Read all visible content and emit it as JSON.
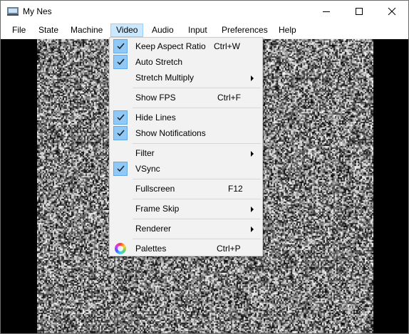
{
  "window": {
    "title": "My Nes"
  },
  "menubar": {
    "items": [
      "File",
      "State",
      "Machine",
      "Video",
      "Audio",
      "Input",
      "Preferences",
      "Help"
    ],
    "open_item": "Video"
  },
  "video_menu": {
    "keep_aspect_ratio": {
      "label": "Keep Aspect Ratio",
      "shortcut": "Ctrl+W",
      "checked": true
    },
    "auto_stretch": {
      "label": "Auto Stretch",
      "checked": true
    },
    "stretch_multiply": {
      "label": "Stretch Multiply",
      "submenu": true
    },
    "show_fps": {
      "label": "Show FPS",
      "shortcut": "Ctrl+F",
      "checked": false
    },
    "hide_lines": {
      "label": "Hide Lines",
      "checked": true
    },
    "show_notifications": {
      "label": "Show Notifications",
      "checked": true
    },
    "filter": {
      "label": "Filter",
      "submenu": true
    },
    "vsync": {
      "label": "VSync",
      "checked": true
    },
    "fullscreen": {
      "label": "Fullscreen",
      "shortcut": "F12"
    },
    "frame_skip": {
      "label": "Frame Skip",
      "submenu": true
    },
    "renderer": {
      "label": "Renderer",
      "submenu": true
    },
    "palettes": {
      "label": "Palettes",
      "shortcut": "Ctrl+P",
      "icon": "palette-icon"
    }
  },
  "colors": {
    "menu_highlight": "#cce8ff",
    "check_bg": "#90c8f6",
    "viewport_bg": "#000000"
  }
}
